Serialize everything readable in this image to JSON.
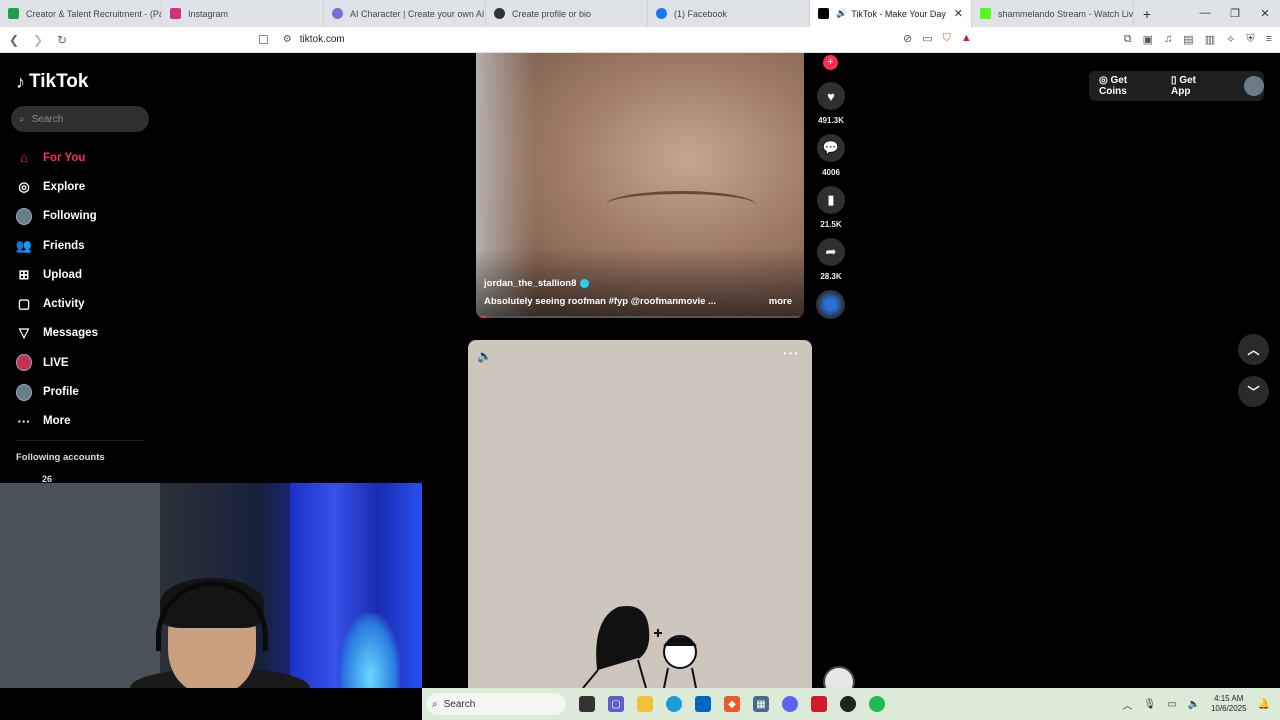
{
  "browser": {
    "tabs": [
      {
        "label": "Creator & Talent Recruitment - (Pay",
        "color": "#1e9e4f"
      },
      {
        "label": "Instagram",
        "color": "#d6307c"
      },
      {
        "label": "AI Character | Create your own AI int",
        "color": "#7a6bd6"
      },
      {
        "label": "Create profile or bio",
        "color": "#333333"
      },
      {
        "label": "(1) Facebook",
        "color": "#1877f2"
      },
      {
        "label": "TikTok - Make Your Day",
        "color": "#000000",
        "active": true
      },
      {
        "label": "shammelando Stream - Watch Live o",
        "color": "#53fc18"
      }
    ],
    "url": "tiktok.com"
  },
  "sidebar": {
    "logo": "TikTok",
    "search_placeholder": "Search",
    "items": [
      {
        "label": "For You",
        "icon": "home-icon",
        "active": true
      },
      {
        "label": "Explore",
        "icon": "compass-icon"
      },
      {
        "label": "Following",
        "icon": "following-avatar"
      },
      {
        "label": "Friends",
        "icon": "friends-icon"
      },
      {
        "label": "Upload",
        "icon": "upload-icon"
      },
      {
        "label": "Activity",
        "icon": "activity-icon"
      },
      {
        "label": "Messages",
        "icon": "messages-icon"
      },
      {
        "label": "LIVE",
        "icon": "live-avatar"
      },
      {
        "label": "Profile",
        "icon": "profile-avatar"
      },
      {
        "label": "More",
        "icon": "more-icon"
      }
    ],
    "following_accounts_label": "Following accounts",
    "following_count": "26"
  },
  "header": {
    "get_coins": "Get Coins",
    "get_app": "Get App"
  },
  "video1": {
    "author": "jordan_the_stallion8",
    "caption": "Absolutely seeing roofman #fyp  @roofmanmovie  ...",
    "more_label": "more",
    "likes": "491.3K",
    "comments": "4006",
    "saves": "21.5K",
    "shares": "28.3K",
    "progress": 0.03
  },
  "taskbar": {
    "search_placeholder": "Search",
    "time": "4:15 AM",
    "date": "10/6/2025"
  },
  "colors": {
    "accent": "#fe2c55",
    "verified": "#20d5ec"
  }
}
